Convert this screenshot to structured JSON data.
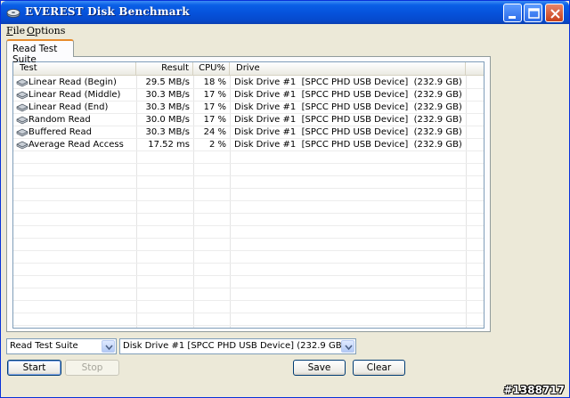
{
  "window": {
    "title": "EVEREST Disk Benchmark"
  },
  "menu": [
    {
      "accel": "F",
      "rest": "ile"
    },
    {
      "accel": "O",
      "rest": "ptions"
    }
  ],
  "tab": {
    "label": "Read Test Suite"
  },
  "table": {
    "headers": [
      "Test",
      "Result",
      "CPU%",
      "Drive"
    ],
    "rows": [
      {
        "test": "Linear Read (Begin)",
        "result": "29.5 MB/s",
        "cpu": "18 %",
        "drive": "Disk Drive #1  [SPCC PHD USB Device]  (232.9 GB)"
      },
      {
        "test": "Linear Read (Middle)",
        "result": "30.3 MB/s",
        "cpu": "17 %",
        "drive": "Disk Drive #1  [SPCC PHD USB Device]  (232.9 GB)"
      },
      {
        "test": "Linear Read (End)",
        "result": "30.3 MB/s",
        "cpu": "17 %",
        "drive": "Disk Drive #1  [SPCC PHD USB Device]  (232.9 GB)"
      },
      {
        "test": "Random Read",
        "result": "30.0 MB/s",
        "cpu": "17 %",
        "drive": "Disk Drive #1  [SPCC PHD USB Device]  (232.9 GB)"
      },
      {
        "test": "Buffered Read",
        "result": "30.3 MB/s",
        "cpu": "24 %",
        "drive": "Disk Drive #1  [SPCC PHD USB Device]  (232.9 GB)"
      },
      {
        "test": "Average Read Access",
        "result": "17.52 ms",
        "cpu": "2 %",
        "drive": "Disk Drive #1  [SPCC PHD USB Device]  (232.9 GB)"
      }
    ]
  },
  "controls": {
    "suite_select": "Read Test Suite",
    "drive_select": "Disk Drive #1  [SPCC PHD USB Device]  (232.9 GB)",
    "start": "Start",
    "stop": "Stop",
    "save": "Save",
    "clear": "Clear"
  },
  "watermark": "#1388717",
  "colors": {
    "titlebar": "#0653dc",
    "face": "#ece9d8",
    "tab_accent": "#e68b2c"
  }
}
